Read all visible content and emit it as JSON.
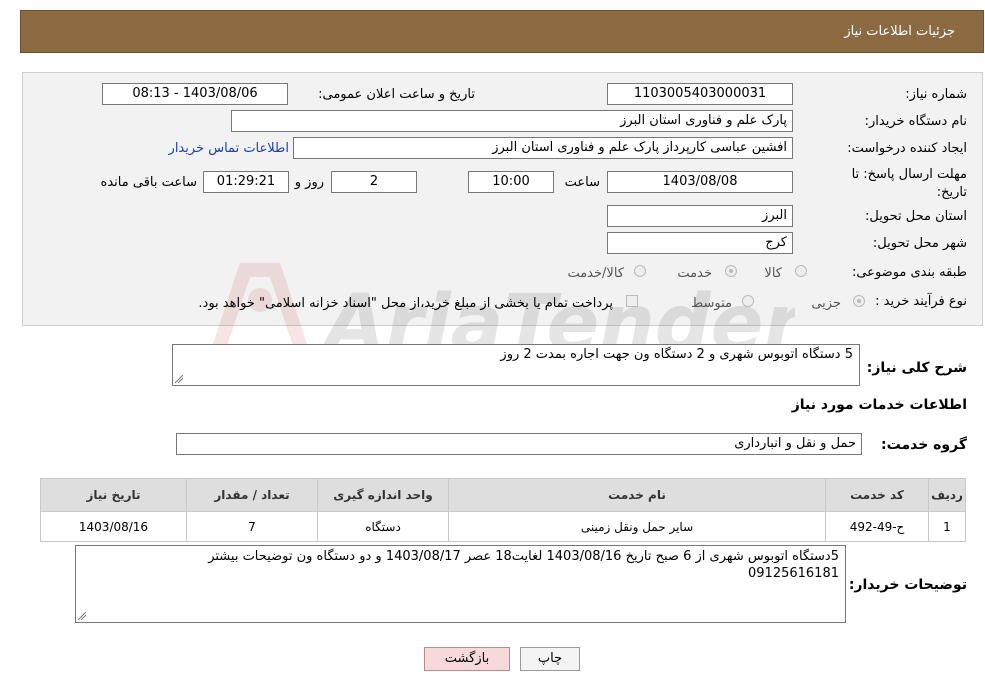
{
  "header": {
    "title": "جزئیات اطلاعات نیاز"
  },
  "form": {
    "need_number_label": "شماره نیاز:",
    "need_number": "1103005403000031",
    "announce_label": "تاریخ و ساعت اعلان عمومی:",
    "announce_value": "1403/08/06 - 08:13",
    "buyer_org_label": "نام دستگاه خریدار:",
    "buyer_org": "پارک علم و فناوری استان البرز",
    "creator_label": "ایجاد کننده درخواست:",
    "creator": "افشین  عباسی  کارپرداز پارک علم و فناوری استان البرز",
    "contact_link": "اطلاعات تماس خریدار",
    "deadline_label": "مهلت ارسال پاسخ: تا تاریخ:",
    "deadline_date": "1403/08/08",
    "time_label": "ساعت",
    "deadline_time": "10:00",
    "days_value": "2",
    "days_label": "روز و",
    "remaining_time": "01:29:21",
    "remaining_label": "ساعت باقی مانده",
    "province_label": "استان محل تحویل:",
    "province": "البرز",
    "city_label": "شهر محل تحویل:",
    "city": "کرج",
    "category_label": "طبقه بندی موضوعی:",
    "category_options": [
      "کالا",
      "خدمت",
      "کالا/خدمت"
    ],
    "purchase_type_label": "نوع فرآیند خرید :",
    "purchase_options": [
      "جزیی",
      "متوسط"
    ],
    "payment_note": "پرداخت تمام یا بخشی از مبلغ خرید،از محل \"اسناد خزانه اسلامی\" خواهد بود."
  },
  "summary": {
    "label": "شرح کلی نیاز:",
    "text": "5 دستگاه اتوبوس شهری و 2 دستگاه ون جهت اجاره بمدت 2 روز"
  },
  "services": {
    "section_title": "اطلاعات خدمات مورد نیاز",
    "group_label": "گروه خدمت:",
    "group_value": "حمل و نقل و انبارداری"
  },
  "table": {
    "headers": [
      "ردیف",
      "کد خدمت",
      "نام خدمت",
      "واحد اندازه گیری",
      "تعداد / مقدار",
      "تاریخ نیاز"
    ],
    "rows": [
      [
        "1",
        "ح-49-492",
        "سایر حمل ونقل زمینی",
        "دستگاه",
        "7",
        "1403/08/16"
      ]
    ]
  },
  "buyer_notes": {
    "label": "توضیحات خریدار:",
    "line1": "5دستگاه اتوبوس شهری از 6 صبح تاریخ 1403/08/16  لغایت18 عصر   1403/08/17 و دو دستگاه ون  توضیحات بیشتر",
    "line2": "09125616181"
  },
  "buttons": {
    "print": "چاپ",
    "back": "بازگشت"
  },
  "watermark": {
    "text": "AriaTender.neT"
  },
  "colors": {
    "header_bg": "#8b6a42",
    "link": "#1a3fbf",
    "back_btn_bg": "#f7d9d9"
  }
}
